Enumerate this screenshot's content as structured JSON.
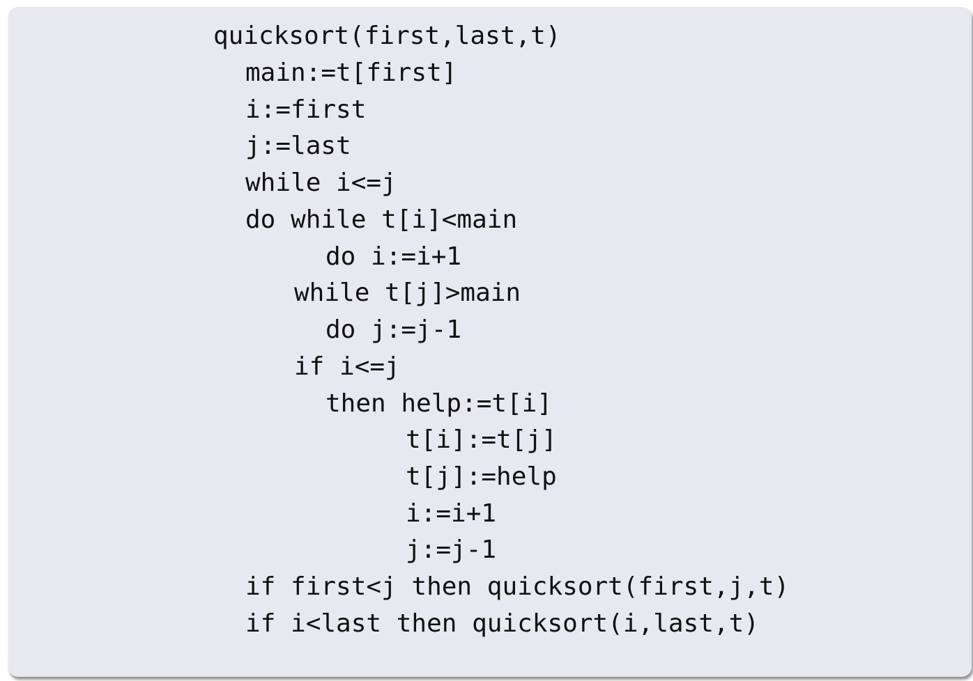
{
  "code_lines": [
    "quicksort(first,last,t)",
    "main:=t[first]",
    "i:=first",
    "j:=last",
    "while i<=j",
    "do while t[i]<main",
    "do i:=i+1",
    "while t[j]>main",
    "do j:=j-1",
    "if i<=j",
    "then help:=t[i]",
    "t[i]:=t[j]",
    "t[j]:=help",
    "i:=i+1",
    "j:=j-1",
    "if first<j then quicksort(first,j,t)",
    "if i<last then quicksort(i,last,t)"
  ]
}
